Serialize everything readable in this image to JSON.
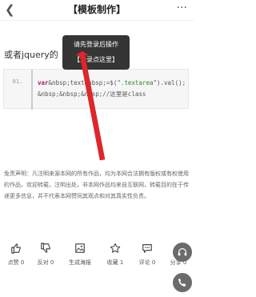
{
  "header": {
    "back_icon": "chevron-left-icon",
    "title": "【模板制作】",
    "more_label": "···"
  },
  "article": {
    "lead_text": "或者jquery的",
    "code": {
      "line_number": "01.",
      "keyword": "var",
      "part1": "&nbsp;text&nbsp;=$(\"",
      "string": ".textarea",
      "part2": "\").val();&nbsp;&nbsp;&nbsp;//这里是class"
    }
  },
  "login_popup": {
    "line1": "请先登录后操作",
    "line2": "【登录点这里】"
  },
  "disclaimer": "免责声明：凡注明来源本网的所有作品，均为本网合法拥有版权或有权使用的作品，欢迎转载，注明出处。非本网作品均来自互联网，转载目的在于传递更多信息，并不代表本网赞同其观点和对其真实性负责。",
  "actions": [
    {
      "icon": "thumbs-up-icon",
      "label": "点赞 0"
    },
    {
      "icon": "thumbs-down-icon",
      "label": "反对 0"
    },
    {
      "icon": "poster-image-icon",
      "label": "生成海报"
    },
    {
      "icon": "star-icon",
      "label": "收藏 1"
    },
    {
      "icon": "comment-icon",
      "label": "评论 0"
    },
    {
      "icon": "share-icon",
      "label": "分享 0"
    }
  ],
  "floating": {
    "headset_icon": "headset-icon",
    "phone_icon": "phone-icon"
  },
  "colors": {
    "annotation_arrow": "#e0262b",
    "keyword": "#a0216b",
    "string": "#2a8a2a",
    "popup_bg": "#141414"
  }
}
